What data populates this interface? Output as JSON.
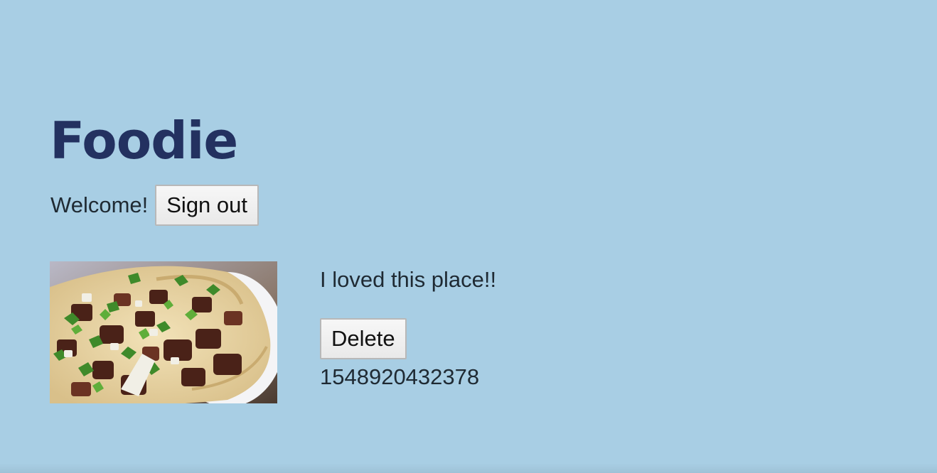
{
  "header": {
    "title": "Foodie",
    "welcome_text": "Welcome!",
    "sign_out_label": "Sign out"
  },
  "posts": [
    {
      "image_icon": "taco-photo",
      "comment": "I loved this place!!",
      "delete_label": "Delete",
      "timestamp": "1548920432378"
    }
  ],
  "colors": {
    "background": "#a8cee4",
    "title": "#233160",
    "text": "#1f2a33"
  }
}
